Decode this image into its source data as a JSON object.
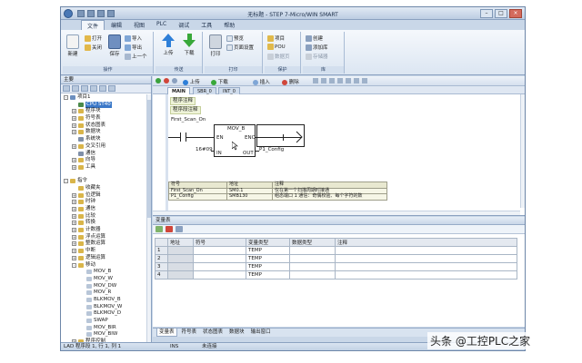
{
  "window": {
    "title": "无标题 - STEP 7-Micro/WIN SMART"
  },
  "ribbon_tabs": [
    "文件",
    "编辑",
    "视图",
    "PLC",
    "调试",
    "工具",
    "帮助"
  ],
  "ribbon": {
    "groups": {
      "ops": "操作",
      "transfer": "传送",
      "print": "打印",
      "protect": "保护",
      "library": "库"
    },
    "buttons": {
      "new": "新建",
      "open": "打开",
      "close": "关闭",
      "save": "保存",
      "import": "导入",
      "export": "导出",
      "previous": "上一个",
      "upload": "上传",
      "download": "下载",
      "print": "打印",
      "preview": "预览",
      "page_setup": "页面设置",
      "project": "项目",
      "pou": "POU",
      "data_page": "数据页",
      "create": "创建",
      "add_library": "添加库",
      "memory": "存储器"
    }
  },
  "left_panel": {
    "title": "主要",
    "tree": [
      {
        "label": "项目1",
        "level": 0,
        "exp": "-",
        "color": "#6c8fbf"
      },
      {
        "label": "CPU ST40",
        "level": 1,
        "exp": "",
        "color": "#4a8a4a",
        "selected": true
      },
      {
        "label": "程序块",
        "level": 1,
        "exp": "+",
        "color": "#d9b54a"
      },
      {
        "label": "符号表",
        "level": 1,
        "exp": "+",
        "color": "#d9b54a"
      },
      {
        "label": "状态图表",
        "level": 1,
        "exp": "+",
        "color": "#d9b54a"
      },
      {
        "label": "数据块",
        "level": 1,
        "exp": "+",
        "color": "#d9b54a"
      },
      {
        "label": "系统块",
        "level": 1,
        "exp": "",
        "color": "#7f8fa8"
      },
      {
        "label": "交叉引用",
        "level": 1,
        "exp": "+",
        "color": "#d9b54a"
      },
      {
        "label": "通信",
        "level": 1,
        "exp": "",
        "color": "#7f8fa8"
      },
      {
        "label": "向导",
        "level": 1,
        "exp": "+",
        "color": "#d9b54a"
      },
      {
        "label": "工具",
        "level": 1,
        "exp": "+",
        "color": "#d9b54a"
      },
      {
        "label": "",
        "level": 0,
        "exp": "",
        "color": ""
      },
      {
        "label": "指令",
        "level": 0,
        "exp": "-",
        "color": "#d9b54a"
      },
      {
        "label": "收藏夹",
        "level": 1,
        "exp": "",
        "color": "#d9b54a"
      },
      {
        "label": "位逻辑",
        "level": 1,
        "exp": "+",
        "color": "#d9b54a"
      },
      {
        "label": "时钟",
        "level": 1,
        "exp": "+",
        "color": "#d9b54a"
      },
      {
        "label": "通信",
        "level": 1,
        "exp": "+",
        "color": "#d9b54a"
      },
      {
        "label": "比较",
        "level": 1,
        "exp": "+",
        "color": "#d9b54a"
      },
      {
        "label": "转换",
        "level": 1,
        "exp": "+",
        "color": "#d9b54a"
      },
      {
        "label": "计数器",
        "level": 1,
        "exp": "+",
        "color": "#d9b54a"
      },
      {
        "label": "浮点运算",
        "level": 1,
        "exp": "+",
        "color": "#d9b54a"
      },
      {
        "label": "整数运算",
        "level": 1,
        "exp": "+",
        "color": "#d9b54a"
      },
      {
        "label": "中断",
        "level": 1,
        "exp": "+",
        "color": "#d9b54a"
      },
      {
        "label": "逻辑运算",
        "level": 1,
        "exp": "+",
        "color": "#d9b54a"
      },
      {
        "label": "移动",
        "level": 1,
        "exp": "-",
        "color": "#d9b54a"
      },
      {
        "label": "MOV_B",
        "level": 2,
        "exp": "",
        "color": "#b8c6d8"
      },
      {
        "label": "MOV_W",
        "level": 2,
        "exp": "",
        "color": "#b8c6d8"
      },
      {
        "label": "MOV_DW",
        "level": 2,
        "exp": "",
        "color": "#b8c6d8"
      },
      {
        "label": "MOV_R",
        "level": 2,
        "exp": "",
        "color": "#b8c6d8"
      },
      {
        "label": "BLKMOV_B",
        "level": 2,
        "exp": "",
        "color": "#b8c6d8"
      },
      {
        "label": "BLKMOV_W",
        "level": 2,
        "exp": "",
        "color": "#b8c6d8"
      },
      {
        "label": "BLKMOV_D",
        "level": 2,
        "exp": "",
        "color": "#b8c6d8"
      },
      {
        "label": "SWAP",
        "level": 2,
        "exp": "",
        "color": "#b8c6d8"
      },
      {
        "label": "MOV_BIR",
        "level": 2,
        "exp": "",
        "color": "#b8c6d8"
      },
      {
        "label": "MOV_BIW",
        "level": 2,
        "exp": "",
        "color": "#b8c6d8"
      },
      {
        "label": "程序控制",
        "level": 1,
        "exp": "+",
        "color": "#d9b54a"
      }
    ]
  },
  "editor": {
    "toolbar": {
      "insert": "插入",
      "delete": "删除",
      "upload": "上传",
      "download": "下载"
    },
    "tabs": [
      "MAIN",
      "SBR_0",
      "INT_0"
    ],
    "program_comment": "程序注释",
    "network_comment": "程序段注释",
    "contact_label": "First_Scan_On",
    "box_name": "MOV_B",
    "pin_en": "EN",
    "pin_eno": "ENO",
    "pin_in": "IN",
    "pin_out": "OUT",
    "in_value": "16#09",
    "out_label": "P1_Config",
    "symbol_table": {
      "headers": [
        "符号",
        "地址",
        "注释"
      ],
      "rows": [
        [
          "First_Scan_On",
          "SM0.1",
          "仅在第一个扫描周期时接通"
        ],
        [
          "P1_Config",
          "SMB130",
          "组态端口 1 通信：奇偶校验、每个字符的数"
        ]
      ]
    }
  },
  "variable_table": {
    "title": "变量表",
    "headers": [
      "",
      "地址",
      "符号",
      "变量类型",
      "数据类型",
      "注释"
    ],
    "rows": [
      [
        "1",
        "",
        "",
        "TEMP",
        "",
        ""
      ],
      [
        "2",
        "",
        "",
        "TEMP",
        "",
        ""
      ],
      [
        "3",
        "",
        "",
        "TEMP",
        "",
        ""
      ],
      [
        "4",
        "",
        "",
        "TEMP",
        "",
        ""
      ]
    ]
  },
  "bottom_tabs": [
    "变量表",
    "符号表",
    "状态图表",
    "数据块",
    "输出窗口"
  ],
  "status": {
    "position": "LAD 程序段 1, 行 1, 列 1",
    "mode": "INS",
    "conn": "未连接"
  },
  "watermark": "头条 @工控PLC之家"
}
